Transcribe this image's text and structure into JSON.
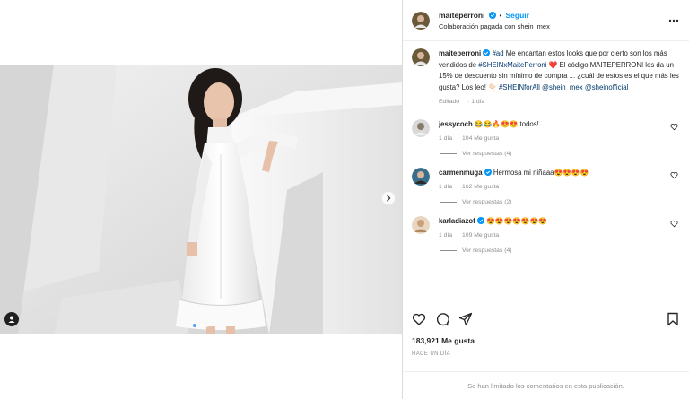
{
  "header": {
    "username": "maiteperroni",
    "separator": "•",
    "follow_label": "Seguir",
    "subtitle": "Colaboración pagada con shein_mex"
  },
  "caption": {
    "username": "maiteperroni",
    "text_1": " ",
    "hashtag_ad": "#ad",
    "text_2": " Me encantan estos looks que por cierto son los más vendidos de ",
    "hashtag_collab": "#SHEINxMaitePerroni",
    "text_3": " ❤️ El código MAITEPERRONI les da un 15% de descuento sin mínimo de compra ... ¿cuál de estos es el que más les gusta? Los leo! 👇🏻",
    "hashtag_forall": "#SHEINforAll",
    "mention_1": "@shein_mex",
    "mention_2": "@sheinofficial",
    "edited": "Editado",
    "time": "1 día"
  },
  "comments": [
    {
      "username": "jessycoch",
      "text": "😂😂🔥😍😍 todos!",
      "time": "1 día",
      "likes": "104 Me gusta",
      "replies": "Ver respuestas (4)"
    },
    {
      "username": "carmenmuga",
      "text": "Hermosa mi niñaaa😍😍😍😍",
      "time": "1 día",
      "likes": "162 Me gusta",
      "replies": "Ver respuestas (2)"
    },
    {
      "username": "karladiazof",
      "text": "😍😍😍😍😍😍😍",
      "time": "1 día",
      "likes": "109 Me gusta",
      "replies": "Ver respuestas (4)"
    }
  ],
  "likes_count": "183,921 Me gusta",
  "timestamp": "HACE UN DÍA",
  "limited_comments": "Se han limitado los comentarios en esta publicación.",
  "colors": {
    "accent": "#0095f6",
    "link": "#00376b",
    "muted": "#8e8e8e",
    "text": "#262626"
  },
  "icons": [
    "verified-icon",
    "more-icon",
    "heart-icon",
    "comment-icon",
    "share-icon",
    "save-icon",
    "next-icon",
    "user-tag-icon"
  ]
}
